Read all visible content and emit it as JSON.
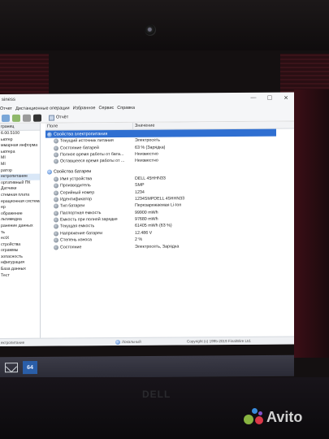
{
  "window": {
    "title": "siness",
    "controls": [
      "—",
      "☐",
      "✕"
    ]
  },
  "menu": [
    "Отчет",
    "Дистанционные операции",
    "Избранное",
    "Сервис",
    "Справка"
  ],
  "toolbar": {
    "report_label": "Отчёт"
  },
  "tree": {
    "header": "границ",
    "items": [
      {
        "label": "6.00.5100",
        "selected": false
      },
      {
        "label": "ьютер",
        "selected": false
      },
      {
        "label": "ммарная информа",
        "selected": false
      },
      {
        "label": "ьютера",
        "selected": false
      },
      {
        "label": "MI",
        "selected": false
      },
      {
        "label": "MI",
        "selected": false
      },
      {
        "label": "ратор",
        "selected": false
      },
      {
        "label": "ектропитание",
        "selected": true
      },
      {
        "label": "ортативный ПК",
        "selected": false
      },
      {
        "label": "Датчики",
        "selected": false
      },
      {
        "label": "стемная плата",
        "selected": false
      },
      {
        "label": "ерационная система",
        "selected": false
      },
      {
        "label": "ер",
        "selected": false
      },
      {
        "label": "ображение",
        "selected": false
      },
      {
        "label": "льтимедиа",
        "selected": false
      },
      {
        "label": "ранение данных",
        "selected": false
      },
      {
        "label": "ть",
        "selected": false
      },
      {
        "label": "ectX",
        "selected": false
      },
      {
        "label": "стройства",
        "selected": false
      },
      {
        "label": "ограммы",
        "selected": false
      },
      {
        "label": "зопасность",
        "selected": false
      },
      {
        "label": "нфигурация",
        "selected": false
      },
      {
        "label": "База данных",
        "selected": false
      },
      {
        "label": "Тест",
        "selected": false
      }
    ]
  },
  "columns": {
    "field": "Поле",
    "value": "Значение"
  },
  "power_section": {
    "title": "Свойства электропитания",
    "rows": [
      {
        "field": "Текущий источник питания",
        "value": "Электросеть"
      },
      {
        "field": "Состояние батарей",
        "value": "63 % (Зарядка)"
      },
      {
        "field": "Полное время работы от бата...",
        "value": "Неизвестно"
      },
      {
        "field": "Оставшееся время работы от ...",
        "value": "Неизвестно"
      }
    ]
  },
  "battery_section": {
    "title": "Свойства батареи",
    "rows": [
      {
        "field": "Имя устройства",
        "value": "DELL 45HHN33"
      },
      {
        "field": "Производитель",
        "value": "SMP"
      },
      {
        "field": "Серийный номер",
        "value": "1234"
      },
      {
        "field": "Идентификатор",
        "value": "1234SMPDELL 45HHN33"
      },
      {
        "field": "Тип батареи",
        "value": "Перезаряжаемая Li-Ion"
      },
      {
        "field": "Паспортная емкость",
        "value": "99900 mWh"
      },
      {
        "field": "Емкость при полной зарядке",
        "value": "97680 mWh"
      },
      {
        "field": "Текущая емкость",
        "value": "61405 mWh  (63 %)"
      },
      {
        "field": "Напряжение батареи",
        "value": "12.486 V"
      },
      {
        "field": "Степень износа",
        "value": "2 %"
      },
      {
        "field": "Состояние",
        "value": "Электросеть, Зарядка"
      }
    ]
  },
  "status": {
    "left": "ектропитание",
    "mid": "Локальный",
    "right": "Copyright (c) 1995-2019 FinalWire Ltd."
  },
  "taskbar": {
    "app_label": "64"
  },
  "bezel": {
    "logo": "DELL"
  },
  "watermark": {
    "text": "Avito"
  }
}
